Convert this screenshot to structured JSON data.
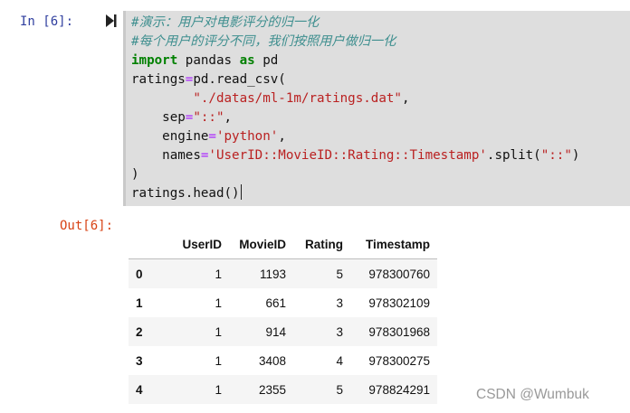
{
  "cell": {
    "in_prompt": "In  [6]:",
    "out_prompt": "Out[6]:",
    "run_icon": "run-cell-icon",
    "code": {
      "comment1": "#演示：用户对电影评分的归一化",
      "comment2": "#每个用户的评分不同，我们按照用户做归一化",
      "import_kw": "import",
      "import_mod": " pandas ",
      "as_kw": "as",
      "import_alias": " pd",
      "l4a": "ratings",
      "l4b": "=",
      "l4c": "pd.read_csv(",
      "l5_indent": "        ",
      "l5_str": "\"./datas/ml-1m/ratings.dat\"",
      "l5_end": ",",
      "l6a": "    sep",
      "l6b": "=",
      "l6_str": "\"::\"",
      "l6_end": ",",
      "l7a": "    engine",
      "l7b": "=",
      "l7_str": "'python'",
      "l7_end": ",",
      "l8a": "    names",
      "l8b": "=",
      "l8_str": "'UserID::MovieID::Rating::Timestamp'",
      "l8c": ".split(",
      "l8_str2": "\"::\"",
      "l8_end": ")",
      "l9": ")",
      "l10": "ratings.head()"
    }
  },
  "table": {
    "columns": [
      "",
      "UserID",
      "MovieID",
      "Rating",
      "Timestamp"
    ],
    "rows": [
      {
        "index": "0",
        "UserID": "1",
        "MovieID": "1193",
        "Rating": "5",
        "Timestamp": "978300760"
      },
      {
        "index": "1",
        "UserID": "1",
        "MovieID": "661",
        "Rating": "3",
        "Timestamp": "978302109"
      },
      {
        "index": "2",
        "UserID": "1",
        "MovieID": "914",
        "Rating": "3",
        "Timestamp": "978301968"
      },
      {
        "index": "3",
        "UserID": "1",
        "MovieID": "3408",
        "Rating": "4",
        "Timestamp": "978300275"
      },
      {
        "index": "4",
        "UserID": "1",
        "MovieID": "2355",
        "Rating": "5",
        "Timestamp": "978824291"
      }
    ]
  },
  "watermark": "CSDN @Wumbuk",
  "colors": {
    "in_prompt": "#303f9f",
    "out_prompt": "#d84315",
    "comment": "#3f8f8f",
    "keyword": "#008000",
    "string": "#ba2121",
    "operator": "#aa22ff",
    "code_bg": "#dedede"
  }
}
